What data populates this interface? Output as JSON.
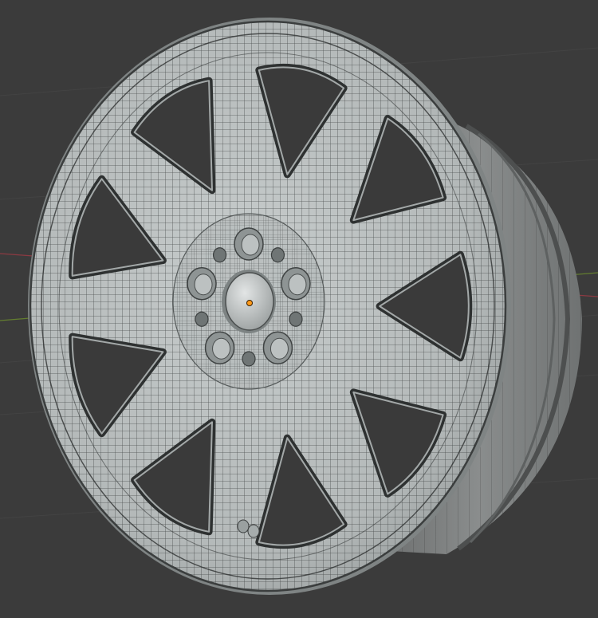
{
  "viewport": {
    "background": "#3b3b3b",
    "grid_color": "#454545",
    "x_axis_color": "#9b3a44",
    "y_axis_color": "#6b8a2e",
    "origin_color": "#ff9a1a"
  },
  "model": {
    "object": "wheel-rim",
    "display": "wireframe-overlay",
    "spoke_count": 9,
    "lug_holes": 5,
    "bolt_circle_holes": 5,
    "surface_color": "#b8bdbd",
    "wire_color": "#2a2d2d"
  }
}
